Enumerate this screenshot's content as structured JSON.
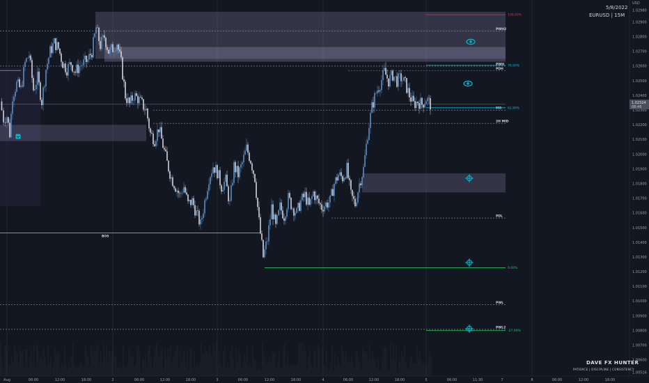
{
  "header": {
    "date": "5/8/2022",
    "symbol": "EURUSD | 15M",
    "currency": "USD"
  },
  "brand": {
    "name": "DAVE FX HUNTER",
    "motto": "PATIENCE  |  DISCIPLINE  |  CONSISTENCY"
  },
  "colors": {
    "background": "#131722",
    "candle_up": "#5b8fc6",
    "candle_down": "#d1d4dc",
    "zone": "#a7a0c8",
    "teal_line": "#00bcd4",
    "green_line": "#22c55e",
    "red_line": "#d0394a",
    "price_tag": "#4a4f5c"
  },
  "chart_data": {
    "type": "candlestick",
    "symbol": "EURUSD",
    "timeframe": "15M",
    "ylim": [
      1.0049,
      1.0305
    ],
    "x_ticks": [
      "Aug",
      "06:00",
      "12:00",
      "18:00",
      "2",
      "06:00",
      "12:00",
      "18:00",
      "3",
      "06:00",
      "12:00",
      "18:00",
      "4",
      "06:00",
      "12:00",
      "18:00",
      "5",
      "06:00",
      "11:30",
      "7",
      "8",
      "06:00",
      "12:00",
      "18:00"
    ],
    "y_ticks": [
      "1.02980",
      "1.02900",
      "1.02800",
      "1.02700",
      "1.02600",
      "1.02500",
      "1.02400",
      "1.02300",
      "1.02200",
      "1.02100",
      "1.02000",
      "1.01900",
      "1.01800",
      "1.01700",
      "1.01600",
      "1.01500",
      "1.01400",
      "1.01300",
      "1.01200",
      "1.01100",
      "1.01000",
      "1.00900",
      "1.00800",
      "1.00700",
      "1.00600",
      "1.00516"
    ],
    "last_price": {
      "value": "1.02324",
      "countdown": "08:46"
    },
    "close_path": [
      [
        0,
        1.0236
      ],
      [
        5,
        1.0224
      ],
      [
        10,
        1.0226
      ],
      [
        14,
        1.0214
      ],
      [
        18,
        1.024
      ],
      [
        24,
        1.0248
      ],
      [
        30,
        1.0244
      ],
      [
        36,
        1.0262
      ],
      [
        42,
        1.0268
      ],
      [
        48,
        1.0244
      ],
      [
        54,
        1.0252
      ],
      [
        60,
        1.0236
      ],
      [
        66,
        1.0258
      ],
      [
        72,
        1.027
      ],
      [
        78,
        1.0276
      ],
      [
        84,
        1.0272
      ],
      [
        90,
        1.0262
      ],
      [
        96,
        1.0258
      ],
      [
        102,
        1.0262
      ],
      [
        108,
        1.0256
      ],
      [
        114,
        1.026
      ],
      [
        120,
        1.0262
      ],
      [
        126,
        1.0264
      ],
      [
        132,
        1.027
      ],
      [
        138,
        1.0286
      ],
      [
        144,
        1.0274
      ],
      [
        150,
        1.028
      ],
      [
        156,
        1.027
      ],
      [
        162,
        1.0272
      ],
      [
        168,
        1.0276
      ],
      [
        174,
        1.0262
      ],
      [
        180,
        1.024
      ],
      [
        186,
        1.0234
      ],
      [
        192,
        1.024
      ],
      [
        198,
        1.0238
      ],
      [
        204,
        1.0234
      ],
      [
        210,
        1.023
      ],
      [
        216,
        1.0214
      ],
      [
        222,
        1.021
      ],
      [
        228,
        1.0218
      ],
      [
        234,
        1.0206
      ],
      [
        240,
        1.0194
      ],
      [
        246,
        1.0184
      ],
      [
        252,
        1.0178
      ],
      [
        258,
        1.0172
      ],
      [
        264,
        1.0178
      ],
      [
        270,
        1.0166
      ],
      [
        276,
        1.0168
      ],
      [
        282,
        1.016
      ],
      [
        288,
        1.0152
      ],
      [
        294,
        1.0168
      ],
      [
        300,
        1.0184
      ],
      [
        306,
        1.0192
      ],
      [
        312,
        1.0188
      ],
      [
        318,
        1.0178
      ],
      [
        324,
        1.0182
      ],
      [
        330,
        1.0166
      ],
      [
        336,
        1.0192
      ],
      [
        342,
        1.0186
      ],
      [
        348,
        1.0194
      ],
      [
        354,
        1.0204
      ],
      [
        360,
        1.0196
      ],
      [
        366,
        1.0184
      ],
      [
        372,
        1.0154
      ],
      [
        378,
        1.013
      ],
      [
        384,
        1.0142
      ],
      [
        390,
        1.0164
      ],
      [
        396,
        1.015
      ],
      [
        402,
        1.0164
      ],
      [
        408,
        1.0158
      ],
      [
        414,
        1.017
      ],
      [
        420,
        1.0164
      ],
      [
        426,
        1.016
      ],
      [
        432,
        1.0168
      ],
      [
        438,
        1.0172
      ],
      [
        444,
        1.0164
      ],
      [
        450,
        1.0174
      ],
      [
        456,
        1.0168
      ],
      [
        462,
        1.0164
      ],
      [
        468,
        1.0166
      ],
      [
        474,
        1.0168
      ],
      [
        480,
        1.018
      ],
      [
        486,
        1.0186
      ],
      [
        492,
        1.0184
      ],
      [
        498,
        1.019
      ],
      [
        504,
        1.0172
      ],
      [
        510,
        1.0166
      ],
      [
        516,
        1.018
      ],
      [
        522,
        1.019
      ],
      [
        528,
        1.0214
      ],
      [
        534,
        1.0232
      ],
      [
        540,
        1.0242
      ],
      [
        546,
        1.0248
      ],
      [
        552,
        1.0256
      ],
      [
        558,
        1.025
      ],
      [
        564,
        1.0254
      ],
      [
        570,
        1.025
      ],
      [
        576,
        1.0252
      ],
      [
        582,
        1.0248
      ],
      [
        588,
        1.024
      ],
      [
        594,
        1.0234
      ],
      [
        600,
        1.0236
      ],
      [
        606,
        1.0234
      ],
      [
        612,
        1.0238
      ],
      [
        618,
        1.0234
      ]
    ],
    "levels": [
      {
        "label": "PWH2",
        "value": 1.0284,
        "style": "dashed",
        "color": "#9598a1"
      },
      {
        "label": "PWH",
        "value": 1.026,
        "style": "dashed",
        "color": "#9598a1"
      },
      {
        "label": "PDH",
        "value": 1.0257,
        "style": "dashed",
        "color": "#9598a1"
      },
      {
        "label": "MO",
        "value": 1.023,
        "style": "dashed",
        "color": "#9598a1"
      },
      {
        "label": "2H MID",
        "value": 1.0221,
        "style": "dashed",
        "color": "#9598a1"
      },
      {
        "label": "PDL",
        "value": 1.01566,
        "style": "dashed",
        "color": "#9598a1"
      },
      {
        "label": "BOS",
        "value": 1.01464,
        "style": "solid",
        "color": "#d1d4dc"
      },
      {
        "label": "PWL",
        "value": 1.00975,
        "style": "dashed",
        "color": "#9598a1"
      },
      {
        "label": "PWL2",
        "value": 1.00808,
        "style": "dashed",
        "color": "#9598a1"
      }
    ],
    "fib_levels": [
      {
        "label": "79.00%",
        "value": 1.02605,
        "color": "#00bcd4"
      },
      {
        "label": "61.80%",
        "value": 1.02316,
        "color": "#00bcd4"
      },
      {
        "label": "0.00%",
        "value": 1.01227,
        "color": "#22c55e"
      },
      {
        "label": "-27.00%",
        "value": 1.008,
        "color": "#22c55e"
      },
      {
        "label": "100.00%",
        "value": 1.0295,
        "color": "#d0394a"
      }
    ],
    "zones": [
      {
        "from": 1.0265,
        "to": 1.0297
      },
      {
        "from": 1.0263,
        "to": 1.0273
      },
      {
        "from": 1.0209,
        "to": 1.022
      },
      {
        "from": 1.0174,
        "to": 1.0187
      }
    ]
  }
}
